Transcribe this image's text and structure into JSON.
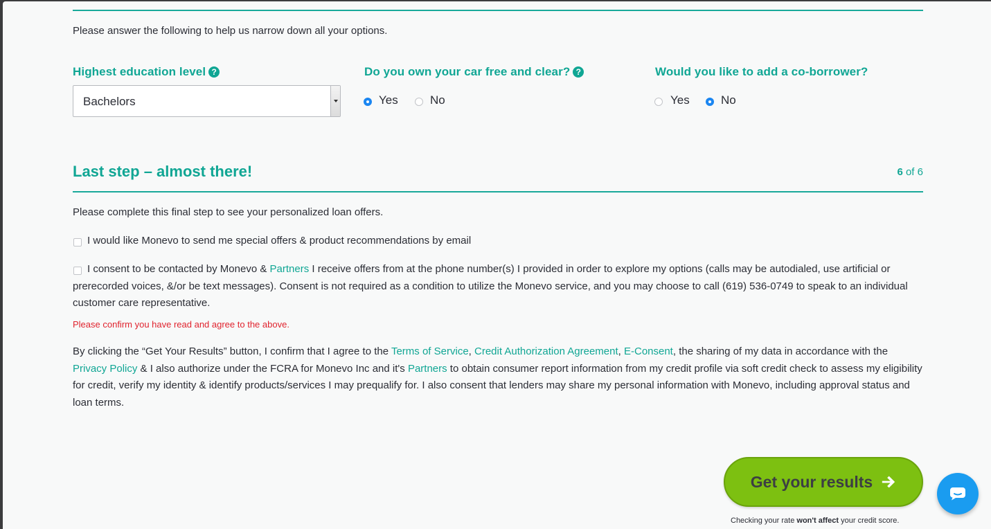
{
  "questions": {
    "intro": "Please answer the following to help us narrow down all your options.",
    "education": {
      "label": "Highest education level",
      "help": "?",
      "selected": "Bachelors"
    },
    "car": {
      "label": "Do you own your car free and clear?",
      "help": "?",
      "options": [
        "Yes",
        "No"
      ],
      "selected": "Yes"
    },
    "coborrower": {
      "label": "Would you like to add a co-borrower?",
      "options": [
        "Yes",
        "No"
      ],
      "selected": "No"
    }
  },
  "final_step": {
    "title": "Last step – almost there!",
    "step_current": "6",
    "step_total": "of 6",
    "intro": "Please complete this final step to see your personalized loan offers.",
    "email_consent": "I would like Monevo to send me special offers & product recommendations by email",
    "phone_consent": {
      "pre": "I consent to be contacted by Monevo & ",
      "partners_link": "Partners",
      "post": " I receive offers from at the phone number(s) I provided in order to explore my options (calls may be autodialed, use artificial or prerecorded voices, &/or be text messages). Consent is not required as a condition to utilize the Monevo service, and you may choose to call (619) 536-0749 to speak to an individual customer care representative."
    },
    "error": "Please confirm you have read and agree to the above.",
    "terms": {
      "part1": "By clicking the “Get Your Results” button, I confirm that I agree to the ",
      "tos_link": "Terms of Service",
      "sep1": ", ",
      "credit_link": "Credit Authorization Agreement",
      "sep2": ", ",
      "econsent_link": "E-Consent",
      "part2": ", the sharing of my data in accordance with the ",
      "privacy_link": "Privacy Policy",
      "part3": " & I also authorize under the FCRA for Monevo Inc and it's ",
      "partners_link": "Partners",
      "part4": " to obtain consumer report information from my credit profile via soft credit check to assess my eligibility for credit, verify my identity & identify products/services I may prequalify for. I also consent that lenders may share my personal information with Monevo, including approval status and loan terms."
    }
  },
  "cta": {
    "label": "Get your results",
    "disclaimer_pre": "Checking your rate ",
    "disclaimer_bold": "won't affect",
    "disclaimer_post": " your credit score."
  },
  "icons": {
    "help": "question-circle-icon",
    "cta": "arrow-right-icon",
    "chat": "chat-bubble-icon"
  },
  "colors": {
    "accent": "#10a694",
    "cta": "#7dc011",
    "error": "#e0232e",
    "radio": "#1b86f1",
    "chat": "#1a9cf0"
  }
}
